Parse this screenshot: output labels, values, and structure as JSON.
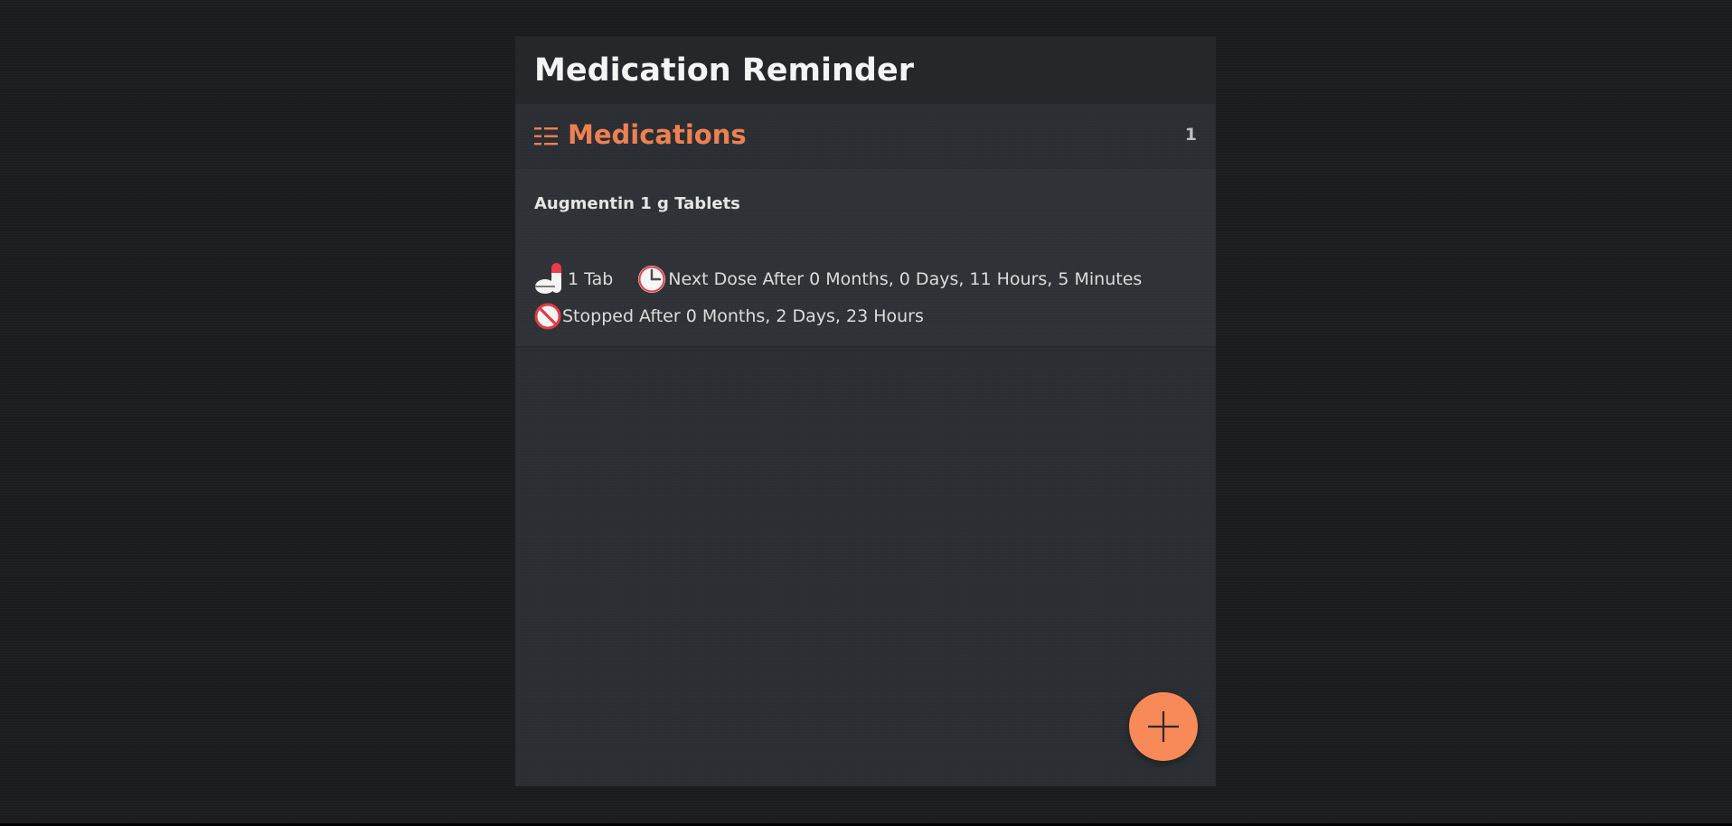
{
  "app": {
    "title": "Medication Reminder"
  },
  "section": {
    "icon": "list-icon",
    "title": "Medications",
    "count": "1"
  },
  "medications": [
    {
      "name": "Augmentin 1 g Tablets",
      "dose": "1 Tab",
      "dose_icon": "pill-icon",
      "next_dose": "Next Dose After 0 Months, 0 Days, 11 Hours, 5 Minutes",
      "next_dose_icon": "clock-icon",
      "stopped": "Stopped After 0 Months, 2 Days, 23 Hours",
      "stopped_icon": "stop-icon"
    }
  ],
  "fab": {
    "icon": "plus-icon"
  },
  "colors": {
    "background": "#1a1c1f",
    "panel": "#2b2f33",
    "header": "#25272a",
    "accent": "#ee8052",
    "fab": "#f78a58",
    "text": "#dcdcdc"
  }
}
